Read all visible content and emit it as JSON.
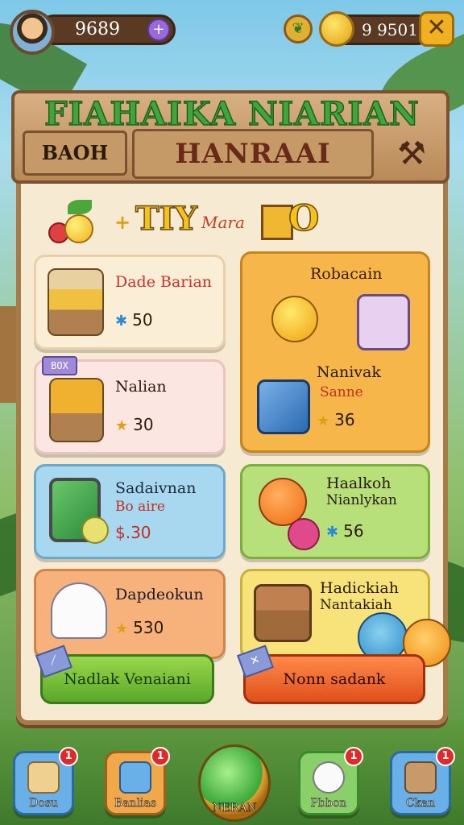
{
  "header": {
    "coins": "9689",
    "gold": "9 9501",
    "title": "FIAHAIKA NIARIAN",
    "search_label": "BAOH",
    "subtitle": "HANRAAI"
  },
  "banner": {
    "bonus_text": "TIY",
    "mara_text": "Mara",
    "box_letter": "O"
  },
  "items": [
    {
      "name": "Dade Barian",
      "price": "50",
      "price_icon": "blue-star"
    },
    {
      "name": "Nalian",
      "price": "30",
      "price_icon": "gold-star",
      "tag": "BOX"
    },
    {
      "name": "Sadaivnan",
      "sub": "Bo aire",
      "price": "$.30",
      "price_icon": "gold-star"
    },
    {
      "name": "Dapdeokun",
      "price": "530",
      "price_icon": "gold-star"
    }
  ],
  "featured": {
    "title": "Robacain",
    "item_name": "Nanivak",
    "item_sub": "Sanne",
    "price": "36"
  },
  "items_right": [
    {
      "name": "Haalkoh",
      "sub": "Nianlykan",
      "price": "56"
    },
    {
      "name": "Hadickiah",
      "sub": "Nantakiah"
    }
  ],
  "actions": {
    "left_label": "Nadlak Venaiani",
    "right_label": "Nonn sadank"
  },
  "nav": [
    {
      "label": "Dosu",
      "badge": "1",
      "color": "#6ab0e8"
    },
    {
      "label": "Banlias",
      "badge": "1",
      "color": "#f0a84a"
    },
    {
      "label": "NERAN",
      "color": "#3aa83a"
    },
    {
      "label": "Pbbon",
      "badge": "1",
      "color": "#8ad06a"
    },
    {
      "label": "Ckan",
      "badge": "1",
      "color": "#6ab0e8"
    }
  ],
  "colors": {
    "board": "#f7ead2",
    "wood": "#a87a48",
    "title_green": "#3ea63a",
    "accent_orange": "#e0501a",
    "accent_green": "#5aa82a"
  }
}
